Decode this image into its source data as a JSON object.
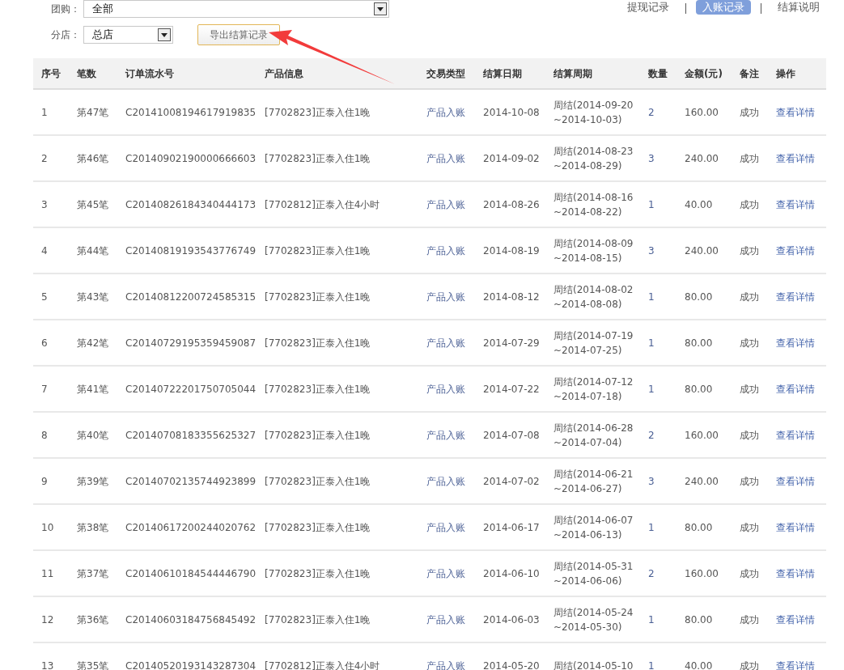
{
  "filters": [
    {
      "label": "团购：",
      "value": "全部",
      "wide": true
    },
    {
      "label": "分店：",
      "value": "总店",
      "wide": false
    }
  ],
  "export_button": "导出结算记录",
  "tabs": [
    {
      "label": "提现记录",
      "selected": false
    },
    {
      "label": "入账记录",
      "selected": true
    },
    {
      "label": "结算说明",
      "selected": false
    }
  ],
  "table": {
    "columns": [
      "序号",
      "笔数",
      "订单流水号",
      "产品信息",
      "交易类型",
      "结算日期",
      "结算周期",
      "数量",
      "金额(元)",
      "备注",
      "操作"
    ],
    "rows": [
      {
        "index": "1",
        "batch": "第47笔",
        "order_no": "C20141008194617919835",
        "product": "[7702823]正泰入住1晚",
        "type": "产品入账",
        "settle_date": "2014-10-08",
        "period": [
          "周结(2014-09-20",
          "~2014-10-03)"
        ],
        "quantity": "2",
        "amount": "160.00",
        "remark": "成功",
        "action": "查看详情"
      },
      {
        "index": "2",
        "batch": "第46笔",
        "order_no": "C20140902190000666603",
        "product": "[7702823]正泰入住1晚",
        "type": "产品入账",
        "settle_date": "2014-09-02",
        "period": [
          "周结(2014-08-23",
          "~2014-08-29)"
        ],
        "quantity": "3",
        "amount": "240.00",
        "remark": "成功",
        "action": "查看详情"
      },
      {
        "index": "3",
        "batch": "第45笔",
        "order_no": "C20140826184340444173",
        "product": "[7702812]正泰入住4小时",
        "type": "产品入账",
        "settle_date": "2014-08-26",
        "period": [
          "周结(2014-08-16",
          "~2014-08-22)"
        ],
        "quantity": "1",
        "amount": "40.00",
        "remark": "成功",
        "action": "查看详情"
      },
      {
        "index": "4",
        "batch": "第44笔",
        "order_no": "C20140819193543776749",
        "product": "[7702823]正泰入住1晚",
        "type": "产品入账",
        "settle_date": "2014-08-19",
        "period": [
          "周结(2014-08-09",
          "~2014-08-15)"
        ],
        "quantity": "3",
        "amount": "240.00",
        "remark": "成功",
        "action": "查看详情"
      },
      {
        "index": "5",
        "batch": "第43笔",
        "order_no": "C20140812200724585315",
        "product": "[7702823]正泰入住1晚",
        "type": "产品入账",
        "settle_date": "2014-08-12",
        "period": [
          "周结(2014-08-02",
          "~2014-08-08)"
        ],
        "quantity": "1",
        "amount": "80.00",
        "remark": "成功",
        "action": "查看详情"
      },
      {
        "index": "6",
        "batch": "第42笔",
        "order_no": "C20140729195359459087",
        "product": "[7702823]正泰入住1晚",
        "type": "产品入账",
        "settle_date": "2014-07-29",
        "period": [
          "周结(2014-07-19",
          "~2014-07-25)"
        ],
        "quantity": "1",
        "amount": "80.00",
        "remark": "成功",
        "action": "查看详情"
      },
      {
        "index": "7",
        "batch": "第41笔",
        "order_no": "C20140722201750705044",
        "product": "[7702823]正泰入住1晚",
        "type": "产品入账",
        "settle_date": "2014-07-22",
        "period": [
          "周结(2014-07-12",
          "~2014-07-18)"
        ],
        "quantity": "1",
        "amount": "80.00",
        "remark": "成功",
        "action": "查看详情"
      },
      {
        "index": "8",
        "batch": "第40笔",
        "order_no": "C20140708183355625327",
        "product": "[7702823]正泰入住1晚",
        "type": "产品入账",
        "settle_date": "2014-07-08",
        "period": [
          "周结(2014-06-28",
          "~2014-07-04)"
        ],
        "quantity": "2",
        "amount": "160.00",
        "remark": "成功",
        "action": "查看详情"
      },
      {
        "index": "9",
        "batch": "第39笔",
        "order_no": "C20140702135744923899",
        "product": "[7702823]正泰入住1晚",
        "type": "产品入账",
        "settle_date": "2014-07-02",
        "period": [
          "周结(2014-06-21",
          "~2014-06-27)"
        ],
        "quantity": "3",
        "amount": "240.00",
        "remark": "成功",
        "action": "查看详情"
      },
      {
        "index": "10",
        "batch": "第38笔",
        "order_no": "C20140617200244020762",
        "product": "[7702823]正泰入住1晚",
        "type": "产品入账",
        "settle_date": "2014-06-17",
        "period": [
          "周结(2014-06-07",
          "~2014-06-13)"
        ],
        "quantity": "1",
        "amount": "80.00",
        "remark": "成功",
        "action": "查看详情"
      },
      {
        "index": "11",
        "batch": "第37笔",
        "order_no": "C20140610184544446790",
        "product": "[7702823]正泰入住1晚",
        "type": "产品入账",
        "settle_date": "2014-06-10",
        "period": [
          "周结(2014-05-31",
          "~2014-06-06)"
        ],
        "quantity": "2",
        "amount": "160.00",
        "remark": "成功",
        "action": "查看详情"
      },
      {
        "index": "12",
        "batch": "第36笔",
        "order_no": "C20140603184756845492",
        "product": "[7702823]正泰入住1晚",
        "type": "产品入账",
        "settle_date": "2014-06-03",
        "period": [
          "周结(2014-05-24",
          "~2014-05-30)"
        ],
        "quantity": "1",
        "amount": "80.00",
        "remark": "成功",
        "action": "查看详情"
      },
      {
        "index": "13",
        "batch": "第35笔",
        "order_no": "C20140520193143287304",
        "product": "[7702812]正泰入住4小时",
        "type": "产品入账",
        "settle_date": "2014-05-20",
        "period": [
          "周结(2014-05-10"
        ],
        "quantity": "1",
        "amount": "40.00",
        "remark": "成功",
        "action": "查看详情"
      }
    ]
  }
}
